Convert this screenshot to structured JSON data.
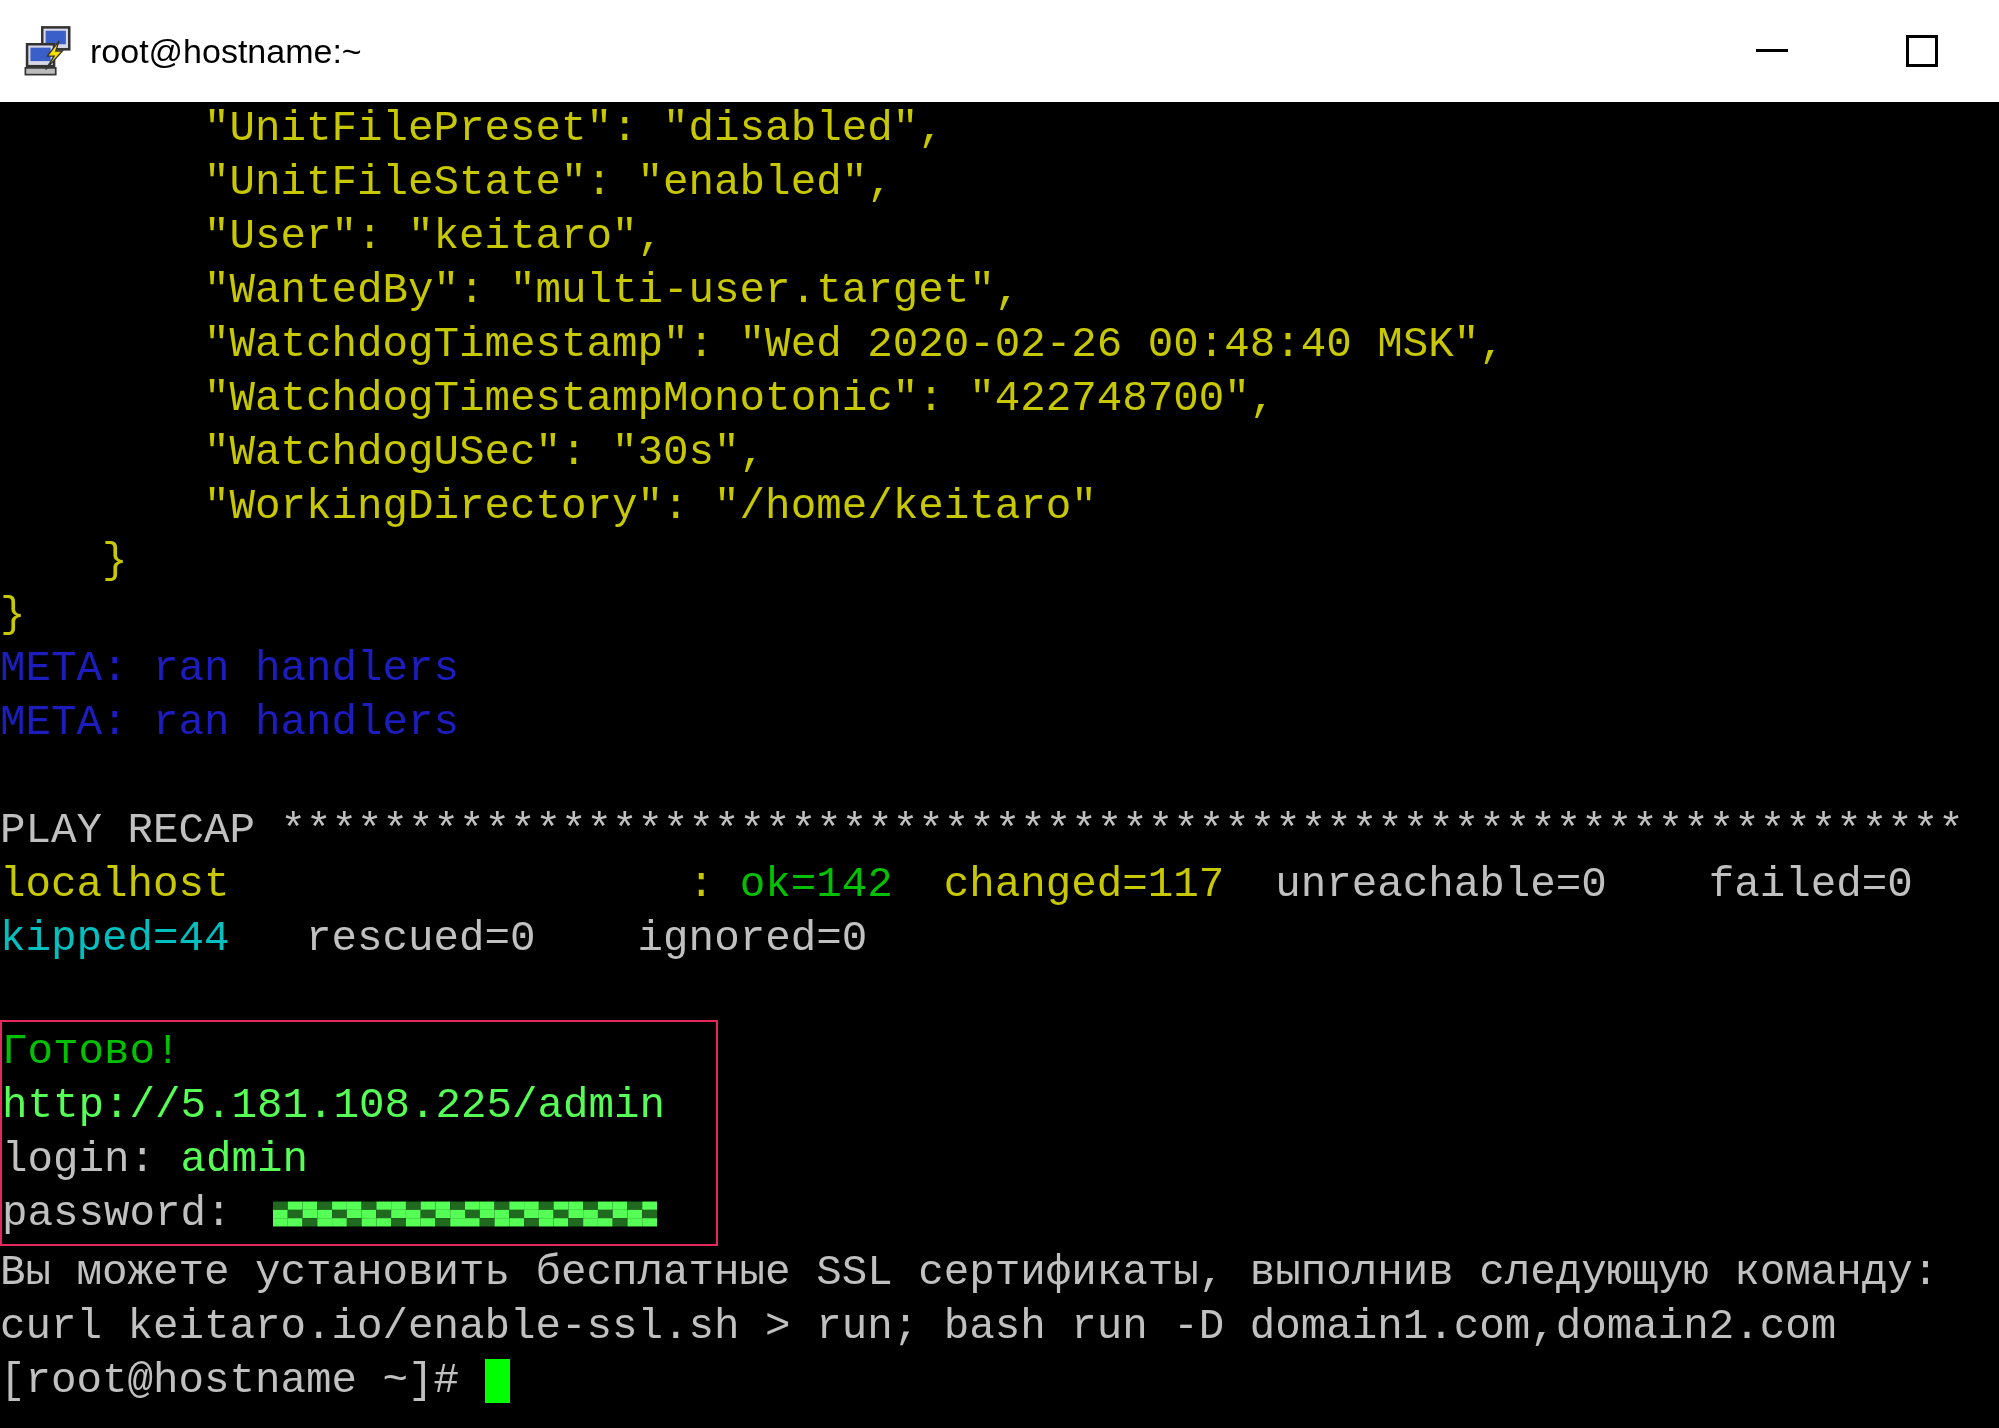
{
  "window": {
    "title": "root@hostname:~"
  },
  "terminal": {
    "lines": [
      {
        "kind": "text",
        "segments": [
          {
            "text": "        \"UnitFilePreset\": \"disabled\",",
            "color": "#c8c800"
          }
        ]
      },
      {
        "kind": "text",
        "segments": [
          {
            "text": "        \"UnitFileState\": \"enabled\",",
            "color": "#c8c800"
          }
        ]
      },
      {
        "kind": "text",
        "segments": [
          {
            "text": "        \"User\": \"keitaro\",",
            "color": "#c8c800"
          }
        ]
      },
      {
        "kind": "text",
        "segments": [
          {
            "text": "        \"WantedBy\": \"multi-user.target\",",
            "color": "#c8c800"
          }
        ]
      },
      {
        "kind": "text",
        "segments": [
          {
            "text": "        \"WatchdogTimestamp\": \"Wed 2020-02-26 00:48:40 MSK\",",
            "color": "#c8c800"
          }
        ]
      },
      {
        "kind": "text",
        "segments": [
          {
            "text": "        \"WatchdogTimestampMonotonic\": \"422748700\",",
            "color": "#c8c800"
          }
        ]
      },
      {
        "kind": "text",
        "segments": [
          {
            "text": "        \"WatchdogUSec\": \"30s\",",
            "color": "#c8c800"
          }
        ]
      },
      {
        "kind": "text",
        "segments": [
          {
            "text": "        \"WorkingDirectory\": \"/home/keitaro\"",
            "color": "#c8c800"
          }
        ]
      },
      {
        "kind": "text",
        "segments": [
          {
            "text": "    }",
            "color": "#c8c800"
          }
        ]
      },
      {
        "kind": "text",
        "segments": [
          {
            "text": "}",
            "color": "#c8c800"
          }
        ]
      },
      {
        "kind": "text",
        "segments": [
          {
            "text": "META: ran handlers",
            "color": "#1c1cbf"
          }
        ]
      },
      {
        "kind": "text",
        "segments": [
          {
            "text": "META: ran handlers",
            "color": "#1c1cbf"
          }
        ]
      },
      {
        "kind": "blank"
      },
      {
        "kind": "text",
        "segments": [
          {
            "text": "PLAY RECAP ******************************************************************",
            "color": "#c0c0c0"
          }
        ]
      },
      {
        "kind": "text",
        "segments": [
          {
            "text": "localhost                  : ",
            "color": "#c8c800"
          },
          {
            "text": "ok=142",
            "color": "#00c000"
          },
          {
            "text": "  changed=117",
            "color": "#c8c800"
          },
          {
            "text": "  unreachable=0    failed=0",
            "color": "#c0c0c0"
          }
        ]
      },
      {
        "kind": "text",
        "segments": [
          {
            "text": "kipped=44",
            "color": "#00bfbf"
          },
          {
            "text": "   rescued=0    ignored=0",
            "color": "#c0c0c0"
          }
        ]
      },
      {
        "kind": "blank"
      },
      {
        "kind": "box",
        "lines": [
          {
            "kind": "text",
            "segments": [
              {
                "text": "Готово!",
                "color": "#00c000"
              }
            ]
          },
          {
            "kind": "text",
            "segments": [
              {
                "text": "http://5.181.108.225/admin",
                "color": "#55ff55"
              }
            ]
          },
          {
            "kind": "text",
            "segments": [
              {
                "text": "login: ",
                "color": "#c0c0c0"
              },
              {
                "text": "admin",
                "color": "#55ff55"
              }
            ]
          },
          {
            "kind": "text",
            "segments": [
              {
                "text": "password: ",
                "color": "#c0c0c0"
              },
              {
                "kind": "redacted",
                "color": "#55ff55"
              }
            ]
          }
        ]
      },
      {
        "kind": "text",
        "segments": [
          {
            "text": "Вы можете установить бесплатные SSL сертификаты, выполнив следующую команду:",
            "color": "#c0c0c0"
          }
        ]
      },
      {
        "kind": "text",
        "segments": [
          {
            "text": "curl keitaro.io/enable-ssl.sh > run; bash run -D domain1.com,domain2.com",
            "color": "#c0c0c0"
          }
        ]
      },
      {
        "kind": "text",
        "segments": [
          {
            "text": "[root@hostname ~]# ",
            "color": "#c0c0c0"
          },
          {
            "kind": "cursor",
            "color": "#00ff00"
          }
        ]
      }
    ]
  }
}
